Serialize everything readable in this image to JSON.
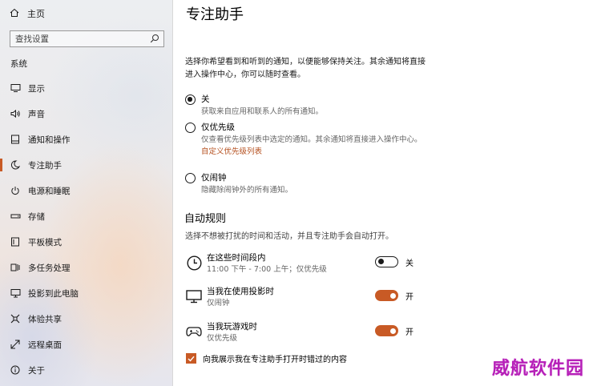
{
  "sidebar": {
    "home_label": "主页",
    "search_placeholder": "查找设置",
    "section_label": "系统",
    "items": [
      {
        "label": "显示",
        "icon": "display-icon"
      },
      {
        "label": "声音",
        "icon": "sound-icon"
      },
      {
        "label": "通知和操作",
        "icon": "notification-icon"
      },
      {
        "label": "专注助手",
        "icon": "moon-icon",
        "active": true
      },
      {
        "label": "电源和睡眠",
        "icon": "power-icon"
      },
      {
        "label": "存储",
        "icon": "storage-icon"
      },
      {
        "label": "平板模式",
        "icon": "tablet-icon"
      },
      {
        "label": "多任务处理",
        "icon": "multitask-icon"
      },
      {
        "label": "投影到此电脑",
        "icon": "project-icon"
      },
      {
        "label": "体验共享",
        "icon": "share-icon"
      },
      {
        "label": "远程桌面",
        "icon": "remote-desktop-icon"
      },
      {
        "label": "关于",
        "icon": "info-icon"
      }
    ]
  },
  "main": {
    "title": "专注助手",
    "intro": "选择你希望看到和听到的通知，以便能够保持关注。其余通知将直接进入操作中心，你可以随时查看。",
    "options": [
      {
        "title": "关",
        "desc": "获取来自应用和联系人的所有通知。",
        "checked": true
      },
      {
        "title": "仅优先级",
        "desc": "仅查看优先级列表中选定的通知。其余通知将直接进入操作中心。",
        "link": "自定义优先级列表",
        "checked": false
      },
      {
        "title": "仅闹钟",
        "desc": "隐藏除闹钟外的所有通知。",
        "checked": false
      }
    ],
    "rules_heading": "自动规则",
    "rules_desc": "选择不想被打扰的时间和活动，并且专注助手会自动打开。",
    "rules": [
      {
        "title": "在这些时间段内",
        "sub": "11:00 下午 - 7:00 上午；仅优先级",
        "icon": "clock-icon",
        "state": "关",
        "on": false
      },
      {
        "title": "当我在使用投影时",
        "sub": "仅闹钟",
        "icon": "monitor-icon",
        "state": "开",
        "on": true
      },
      {
        "title": "当我玩游戏时",
        "sub": "仅优先级",
        "icon": "gamepad-icon",
        "state": "开",
        "on": true
      }
    ],
    "checkbox_label": "向我展示我在专注助手打开时错过的内容",
    "checkbox_checked": true
  },
  "watermark": "威航软件园",
  "colors": {
    "accent": "#c85a25",
    "link": "#b5501f",
    "watermark": "#b620b8"
  }
}
